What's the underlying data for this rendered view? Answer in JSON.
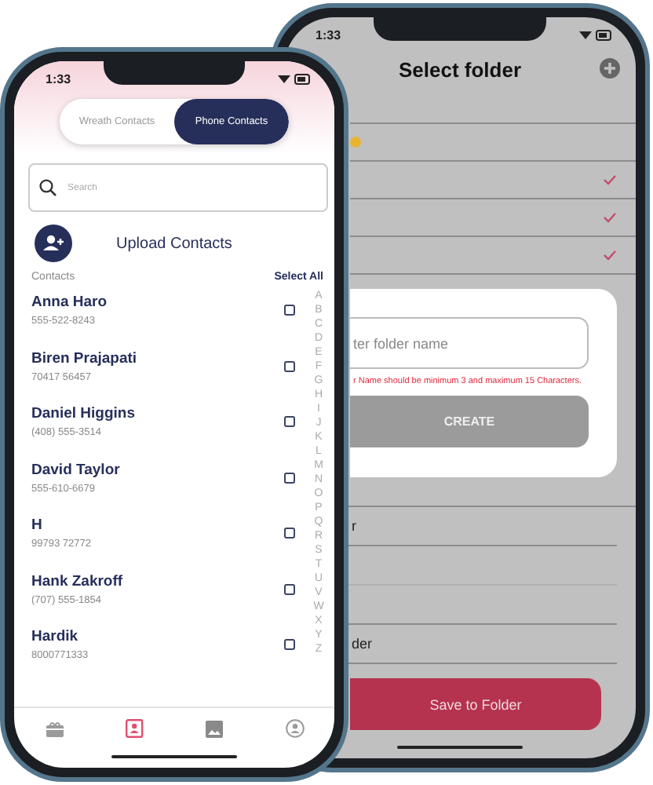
{
  "back_phone": {
    "status_time": "1:33",
    "title": "Select folder",
    "folders_top": [
      {
        "kind": "emoji",
        "checked": false
      },
      {
        "kind": "plain",
        "checked": true
      },
      {
        "kind": "plain",
        "checked": true
      },
      {
        "kind": "plain",
        "checked": true
      }
    ],
    "dialog": {
      "placeholder": "ter folder name",
      "error": "r Name should be minimum 3 and maximum 15 Characters.",
      "button": "CREATE"
    },
    "folders_bottom": [
      {
        "kind": "named",
        "name": "r"
      },
      {
        "kind": "blank"
      },
      {
        "kind": "blank"
      },
      {
        "kind": "named",
        "name": "der"
      }
    ],
    "save_button": "Save to Folder"
  },
  "front_phone": {
    "status_time": "1:33",
    "tabs": [
      {
        "label": "Wreath Contacts",
        "selected": false
      },
      {
        "label": "Phone Contacts",
        "selected": true
      }
    ],
    "search": {
      "placeholder": "Search"
    },
    "upload_label": "Upload Contacts",
    "list_label": "Contacts",
    "select_all": "Select All",
    "contacts": [
      {
        "name": "Anna Haro",
        "phone": "555-522-8243",
        "checked": false
      },
      {
        "name": "Biren Prajapati",
        "phone": "70417 56457",
        "checked": false
      },
      {
        "name": "Daniel Higgins",
        "phone": "(408) 555-3514",
        "checked": false
      },
      {
        "name": "David Taylor",
        "phone": "555-610-6679",
        "checked": false
      },
      {
        "name": "H",
        "phone": "99793 72772",
        "checked": false
      },
      {
        "name": "Hank Zakroff",
        "phone": "(707) 555-1854",
        "checked": false
      },
      {
        "name": "Hardik",
        "phone": "8000771333",
        "checked": false
      }
    ],
    "index_letters": [
      "A",
      "B",
      "C",
      "D",
      "E",
      "F",
      "G",
      "H",
      "I",
      "J",
      "K",
      "L",
      "M",
      "N",
      "O",
      "P",
      "Q",
      "R",
      "S",
      "T",
      "U",
      "V",
      "W",
      "X",
      "Y",
      "Z"
    ],
    "nav": [
      {
        "kind": "gift",
        "selected": false
      },
      {
        "kind": "contacts",
        "selected": true
      },
      {
        "kind": "gallery",
        "selected": false
      },
      {
        "kind": "profile",
        "selected": false
      }
    ]
  }
}
